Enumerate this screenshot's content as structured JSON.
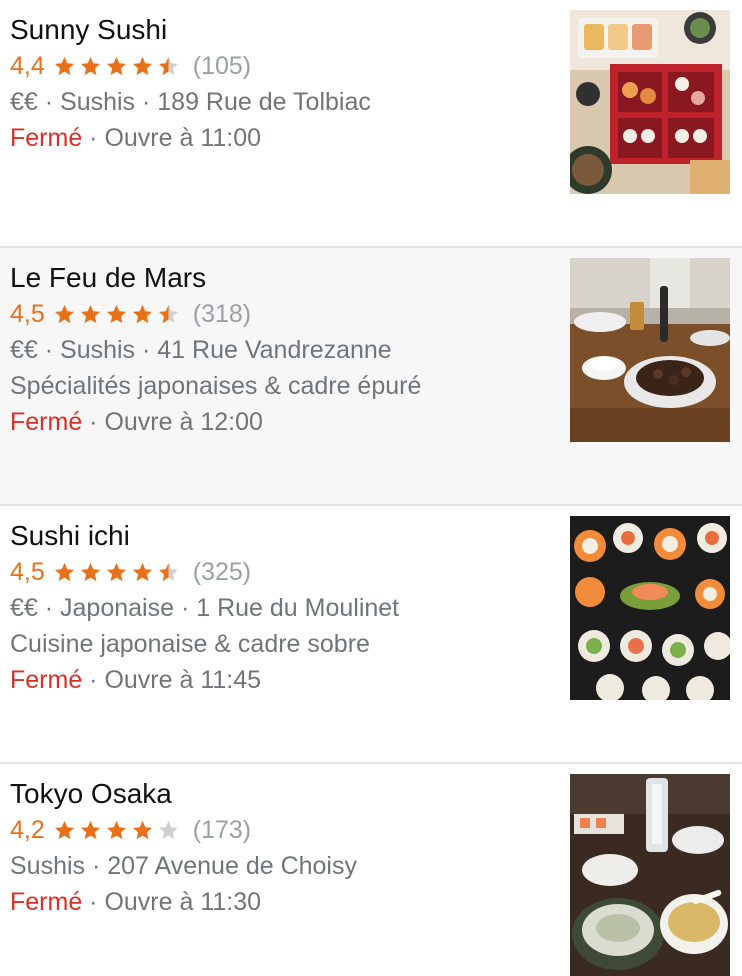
{
  "colors": {
    "rating": "#e7711b",
    "closed": "#d93025",
    "muted": "#70757a",
    "star_empty": "#d0d0d0"
  },
  "restaurants": [
    {
      "name": "Sunny Sushi",
      "rating": "4,4",
      "stars_value": 4.5,
      "reviews": "(105)",
      "details": "€€ · Sushis · 189 Rue de Tolbiac",
      "description": "",
      "status": "Fermé",
      "hours": " · Ouvre à 11:00",
      "photo": "sushi-bento-photo"
    },
    {
      "name": "Le Feu de Mars",
      "rating": "4,5",
      "stars_value": 4.5,
      "reviews": "(318)",
      "details": "€€ · Sushis · 41 Rue Vandrezanne",
      "description": "Spécialités japonaises & cadre épuré",
      "status": "Fermé",
      "hours": " · Ouvre à 12:00",
      "photo": "teppanyaki-table-photo"
    },
    {
      "name": "Sushi ichi",
      "rating": "4,5",
      "stars_value": 4.5,
      "reviews": "(325)",
      "details": "€€ · Japonaise · 1 Rue du Moulinet",
      "description": "Cuisine japonaise & cadre sobre",
      "status": "Fermé",
      "hours": " · Ouvre à 11:45",
      "photo": "maki-platter-photo"
    },
    {
      "name": "Tokyo Osaka",
      "rating": "4,2",
      "stars_value": 4,
      "reviews": "(173)",
      "details": "Sushis · 207 Avenue de Choisy",
      "description": "",
      "status": "Fermé",
      "hours": " · Ouvre à 11:30",
      "photo": "soup-bowls-photo"
    }
  ]
}
